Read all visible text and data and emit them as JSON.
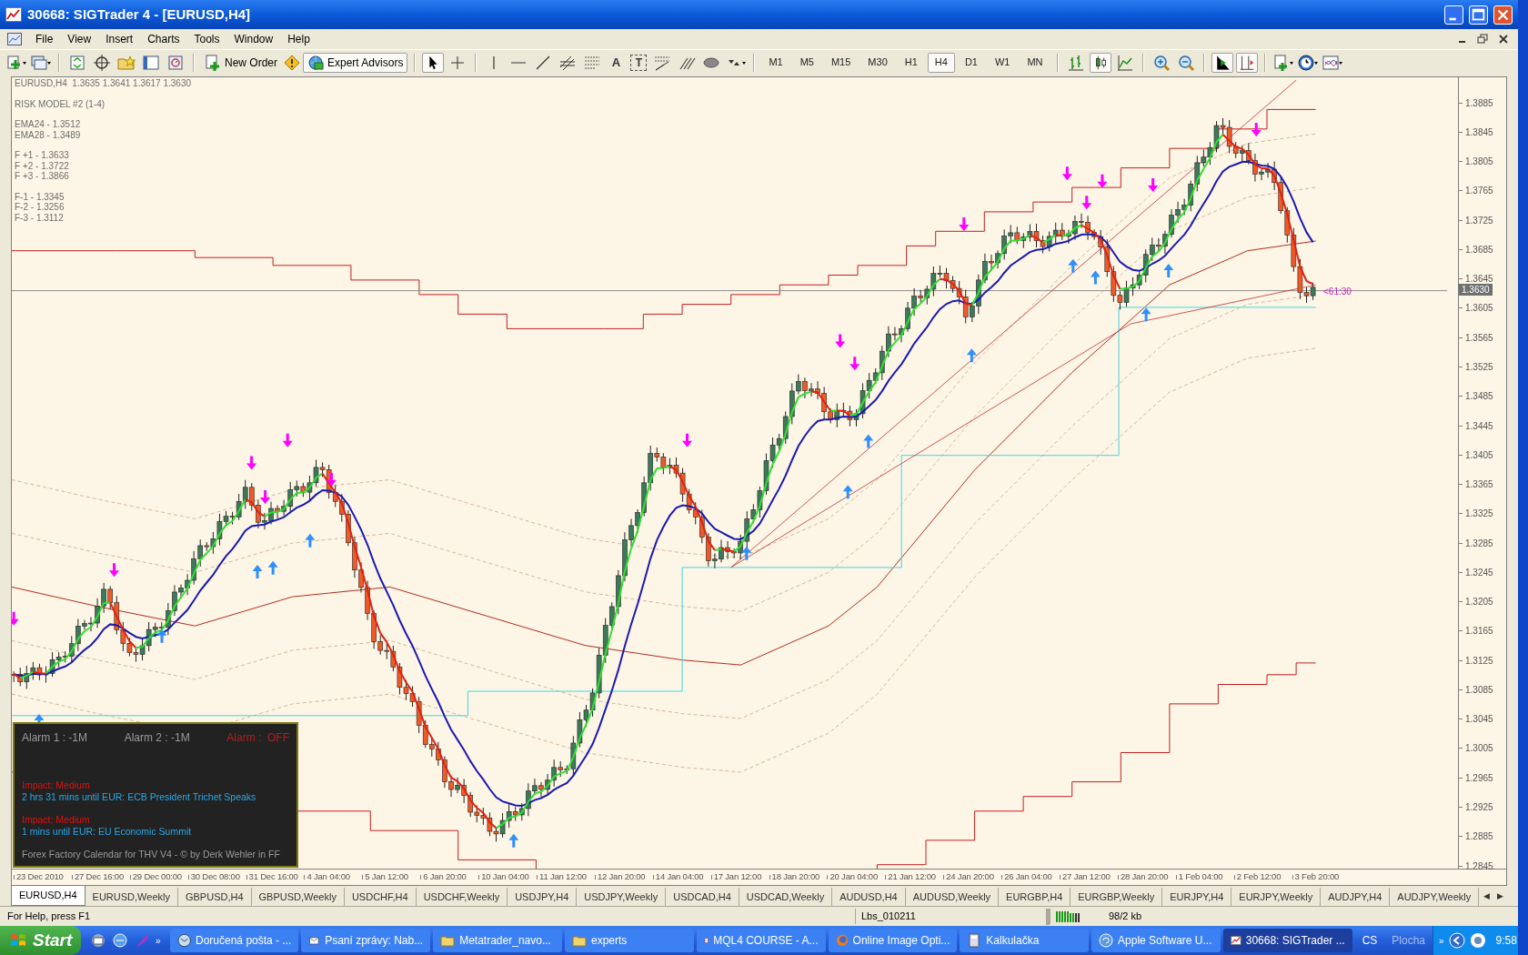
{
  "window": {
    "title": "30668: SIGTrader 4 - [EURUSD,H4]"
  },
  "menu": [
    "File",
    "View",
    "Insert",
    "Charts",
    "Tools",
    "Window",
    "Help"
  ],
  "toolbar": {
    "new_order": "New Order",
    "expert_advisors": "Expert Advisors",
    "text_tool": "A",
    "label_tool": "T",
    "timeframes": [
      {
        "label": "M1",
        "selected": false
      },
      {
        "label": "M5",
        "selected": false
      },
      {
        "label": "M15",
        "selected": false
      },
      {
        "label": "M30",
        "selected": false
      },
      {
        "label": "H1",
        "selected": false
      },
      {
        "label": "H4",
        "selected": true
      },
      {
        "label": "D1",
        "selected": false
      },
      {
        "label": "W1",
        "selected": false
      },
      {
        "label": "MN",
        "selected": false
      }
    ],
    "chart_types": [
      {
        "kind": "bars",
        "selected": false
      },
      {
        "kind": "candles",
        "selected": true
      },
      {
        "kind": "line",
        "selected": false
      }
    ],
    "autoscroll": {
      "on": true
    },
    "chart_shift": {
      "on": true
    }
  },
  "chart": {
    "info_groups": [
      [
        "EURUSD,H4  1.3635 1.3641 1.3617 1.3630"
      ],
      [
        "RISK MODEL #2 (1-4)"
      ],
      [
        "EMA24 - 1.3512",
        "EMA28 - 1.3489"
      ],
      [
        "F +1 - 1.3633",
        "F +2 - 1.3722",
        "F +3 - 1.3866"
      ],
      [
        "F-1 - 1.3345",
        "F-2 - 1.3256",
        "F-3 - 1.3112"
      ]
    ],
    "price_axis": [
      "1.3885",
      "1.3845",
      "1.3805",
      "1.3765",
      "1.3725",
      "1.3685",
      "1.3645",
      "1.3605",
      "1.3565",
      "1.3525",
      "1.3485",
      "1.3445",
      "1.3405",
      "1.3365",
      "1.3325",
      "1.3285",
      "1.3245",
      "1.3205",
      "1.3165",
      "1.3125",
      "1.3085",
      "1.3045",
      "1.3005",
      "1.2965",
      "1.2925",
      "1.2885",
      "1.2845"
    ],
    "current_price": "1.3630",
    "countdown": "<61:30",
    "time_axis": [
      "23 Dec 2010",
      "27 Dec 16:00",
      "29 Dec 00:00",
      "30 Dec 08:00",
      "31 Dec 16:00",
      "4 Jan 04:00",
      "5 Jan 12:00",
      "6 Jan 20:00",
      "10 Jan 04:00",
      "11 Jan 12:00",
      "12 Jan 20:00",
      "14 Jan 04:00",
      "17 Jan 12:00",
      "18 Jan 20:00",
      "20 Jan 04:00",
      "21 Jan 12:00",
      "24 Jan 20:00",
      "26 Jan 04:00",
      "27 Jan 12:00",
      "28 Jan 20:00",
      "1 Feb 04:00",
      "2 Feb 12:00",
      "3 Feb 20:00"
    ],
    "alert_panel": {
      "alarm_1": "Alarm 1 : -1M",
      "alarm_2": "Alarm 2 : -1M",
      "alarm_status": "Alarm :  OFF",
      "events": [
        {
          "impact": "Impact: Medium",
          "text": "2 hrs 31 mins until EUR: ECB President Trichet Speaks"
        },
        {
          "impact": "Impact: Medium",
          "text": "1 mins until EUR: EU Economic Summit"
        }
      ],
      "footer": "Forex Factory Calendar for THV V4 - © by Derk Wehler in FF"
    }
  },
  "chart_tabs": [
    {
      "label": "EURUSD,H4",
      "selected": true
    },
    {
      "label": "EURUSD,Weekly",
      "selected": false
    },
    {
      "label": "GBPUSD,H4",
      "selected": false
    },
    {
      "label": "GBPUSD,Weekly",
      "selected": false
    },
    {
      "label": "USDCHF,H4",
      "selected": false
    },
    {
      "label": "USDCHF,Weekly",
      "selected": false
    },
    {
      "label": "USDJPY,H4",
      "selected": false
    },
    {
      "label": "USDJPY,Weekly",
      "selected": false
    },
    {
      "label": "USDCAD,H4",
      "selected": false
    },
    {
      "label": "USDCAD,Weekly",
      "selected": false
    },
    {
      "label": "AUDUSD,H4",
      "selected": false
    },
    {
      "label": "AUDUSD,Weekly",
      "selected": false
    },
    {
      "label": "EURGBP,H4",
      "selected": false
    },
    {
      "label": "EURGBP,Weekly",
      "selected": false
    },
    {
      "label": "EURJPY,H4",
      "selected": false
    },
    {
      "label": "EURJPY,Weekly",
      "selected": false
    },
    {
      "label": "AUDJPY,H4",
      "selected": false
    },
    {
      "label": "AUDJPY,Weekly",
      "selected": false
    }
  ],
  "tab_scroll": [
    "◀",
    "▶"
  ],
  "status_bar": {
    "help": "For Help, press F1",
    "profile": "Lbs_010211",
    "traffic": "98/2 kb"
  },
  "taskbar": {
    "start": "Start",
    "more": "»",
    "tasks": [
      {
        "label": "Doručená pošta - ...",
        "kind": "mail",
        "selected": false
      },
      {
        "label": "Psaní zprávy: Nab...",
        "kind": "compose",
        "selected": false
      },
      {
        "label": "Metatrader_navo...",
        "kind": "folder",
        "selected": false
      },
      {
        "label": "experts",
        "kind": "folder",
        "selected": false
      },
      {
        "label": "MQL4 COURSE - A...",
        "kind": "pdf",
        "selected": false
      },
      {
        "label": "Online Image Opti...",
        "kind": "browser",
        "selected": false
      },
      {
        "label": "Kalkulačka",
        "kind": "calculator",
        "selected": false
      },
      {
        "label": "Apple Software U...",
        "kind": "update",
        "selected": false
      },
      {
        "label": "30668: SIGTrader ...",
        "kind": "chart",
        "selected": true
      }
    ],
    "language": "CS",
    "desktop": "Plocha",
    "tray_more": "»",
    "clock": "9:58"
  }
}
